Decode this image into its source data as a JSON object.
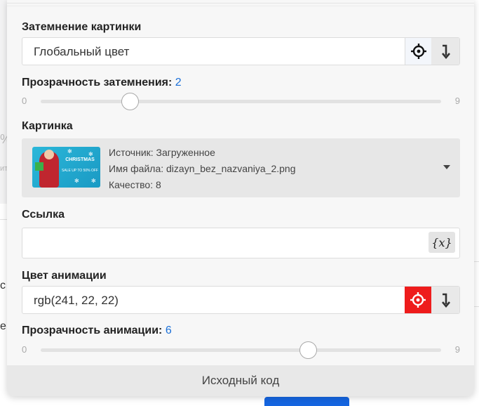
{
  "background": {
    "left_fragment_1": "%",
    "left_fragment_2": "ит",
    "left_fragment_3": "с",
    "left_fragment_4": "е"
  },
  "dimming": {
    "label": "Затемнение картинки",
    "value": "Глобальный цвет"
  },
  "dimming_opacity": {
    "label": "Прозрачность затемнения:",
    "value": "2",
    "min": "0",
    "max": "9",
    "level": 2
  },
  "picture": {
    "label": "Картинка",
    "source": "Источник: Загруженное",
    "filename": "Имя файла: dizayn_bez_nazvaniya_2.png",
    "quality": "Качество: 8",
    "thumb_title": "CHRISTMAS",
    "thumb_sub": "SALE UP TO 50% OFF"
  },
  "link": {
    "label": "Ссылка",
    "value": "",
    "var_button": "{x}"
  },
  "animation_color": {
    "label": "Цвет анимации",
    "value": "rgb(241, 22, 22)",
    "accent": "#ee1c1c"
  },
  "animation_opacity": {
    "label": "Прозрачность анимации:",
    "value": "6",
    "min": "0",
    "max": "9",
    "level": 6
  },
  "footer": {
    "label": "Исходный код"
  }
}
